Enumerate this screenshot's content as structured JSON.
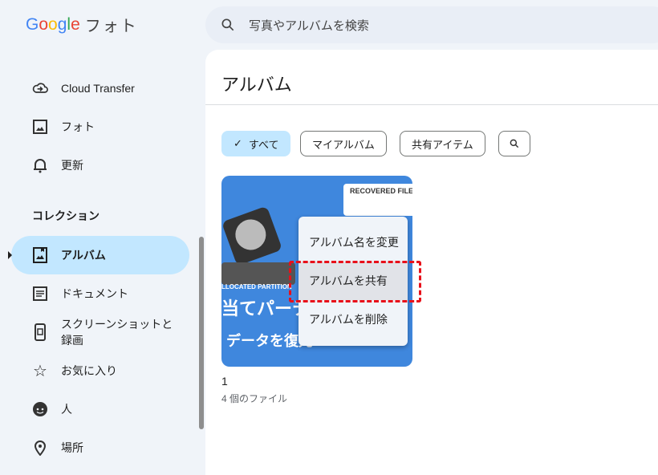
{
  "header": {
    "logo_text": "Google",
    "app_name": "フォト",
    "search_placeholder": "写真やアルバムを検索"
  },
  "sidebar": {
    "items": [
      {
        "label": "Cloud Transfer",
        "icon": "cloud-transfer-icon"
      },
      {
        "label": "フォト",
        "icon": "photo-icon"
      },
      {
        "label": "更新",
        "icon": "bell-icon"
      }
    ],
    "section_label": "コレクション",
    "collections": [
      {
        "label": "アルバム",
        "icon": "album-icon",
        "active": true
      },
      {
        "label": "ドキュメント",
        "icon": "document-icon"
      },
      {
        "label": "スクリーンショットと録画",
        "icon": "phone-icon"
      },
      {
        "label": "お気に入り",
        "icon": "star-icon"
      },
      {
        "label": "人",
        "icon": "face-icon"
      },
      {
        "label": "場所",
        "icon": "location-icon"
      }
    ]
  },
  "main": {
    "title": "アルバム",
    "filters": [
      {
        "label": "すべて",
        "selected": true
      },
      {
        "label": "マイアルバム"
      },
      {
        "label": "共有アイテム"
      }
    ],
    "album": {
      "name": "1",
      "count": "4 個のファイル",
      "thumb_text1": "当てパーティ",
      "thumb_text2": "データを復元",
      "thumb_badge": "RECOVERED FILES",
      "thumb_partition": "LLOCATED PARTITION"
    },
    "context_menu": [
      "アルバム名を変更",
      "アルバムを共有",
      "アルバムを削除"
    ],
    "highlighted_item": "アルバムを共有"
  },
  "colors": {
    "active": "#c2e7ff",
    "highlight_box": "#e8101a",
    "thumb_bg": "#3f87dd"
  }
}
